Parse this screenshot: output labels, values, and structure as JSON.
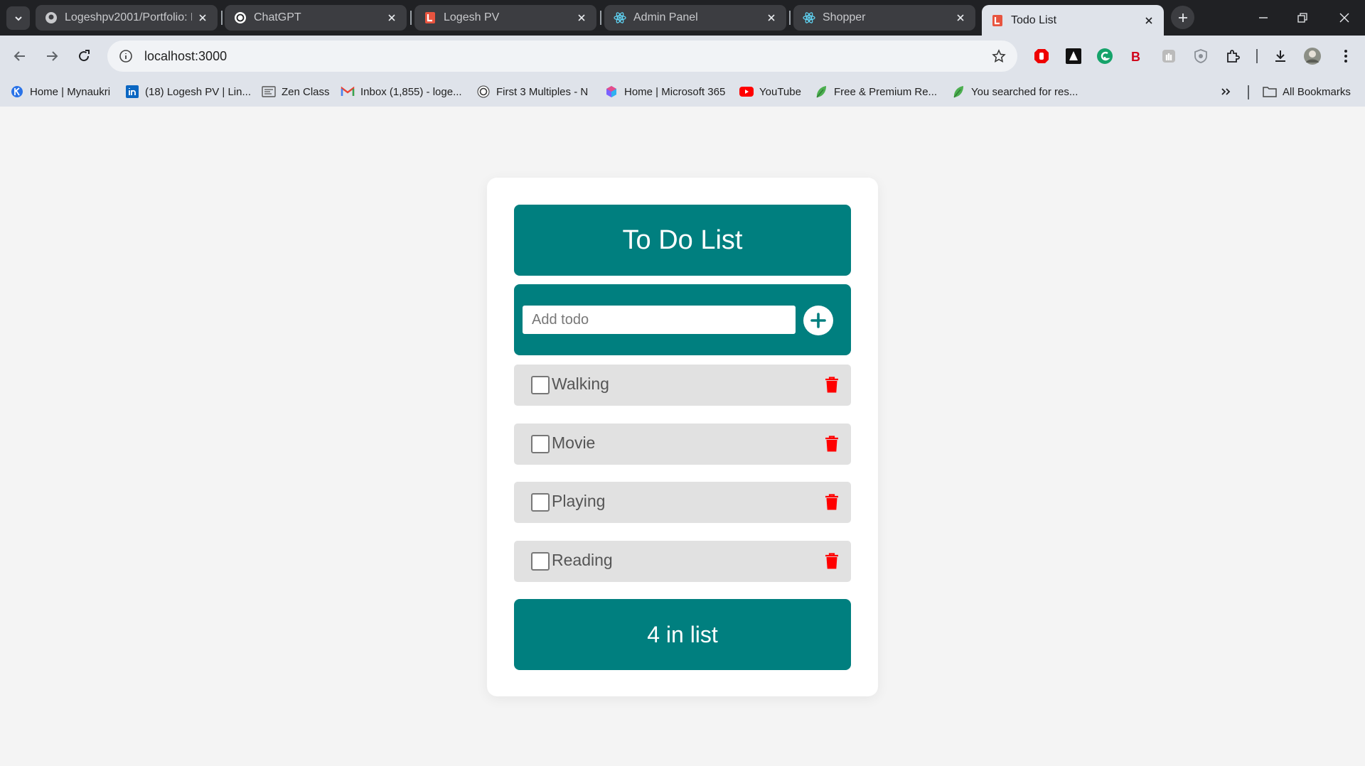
{
  "browser": {
    "tabs": [
      {
        "title": "Logeshpv2001/Portfolio: D",
        "icon": "github-icon",
        "active": false
      },
      {
        "title": "ChatGPT",
        "icon": "chatgpt-icon",
        "active": false
      },
      {
        "title": "Logesh PV",
        "icon": "portfolio-icon",
        "active": false
      },
      {
        "title": "Admin Panel",
        "icon": "react-icon",
        "active": false
      },
      {
        "title": "Shopper",
        "icon": "react-icon",
        "active": false
      },
      {
        "title": "Todo List",
        "icon": "portfolio-icon",
        "active": true
      }
    ],
    "url": "localhost:3000",
    "bookmarks": [
      {
        "label": "Home | Mynaukri",
        "icon": "naukri-icon"
      },
      {
        "label": "(18) Logesh PV | Lin...",
        "icon": "linkedin-icon"
      },
      {
        "label": "Zen Class",
        "icon": "zen-icon"
      },
      {
        "label": "Inbox (1,855) - loge...",
        "icon": "gmail-icon"
      },
      {
        "label": "First 3 Multiples - N",
        "icon": "chatgpt-icon"
      },
      {
        "label": "Home | Microsoft 365",
        "icon": "microsoft365-icon"
      },
      {
        "label": "YouTube",
        "icon": "youtube-icon"
      },
      {
        "label": "Free & Premium Re...",
        "icon": "leaf-icon"
      },
      {
        "label": "You searched for res...",
        "icon": "leaf-icon"
      }
    ],
    "all_bookmarks_label": "All Bookmarks"
  },
  "app": {
    "title": "To Do List",
    "input": {
      "placeholder": "Add todo",
      "value": ""
    },
    "todos": [
      {
        "text": "Walking",
        "done": false
      },
      {
        "text": "Movie",
        "done": false
      },
      {
        "text": "Playing",
        "done": false
      },
      {
        "text": "Reading",
        "done": false
      }
    ],
    "count_label": "4 in list"
  },
  "colors": {
    "primary": "#007f7f",
    "delete": "#ff0000",
    "item_bg": "#e1e1e1",
    "page_bg": "#f4f4f4"
  }
}
